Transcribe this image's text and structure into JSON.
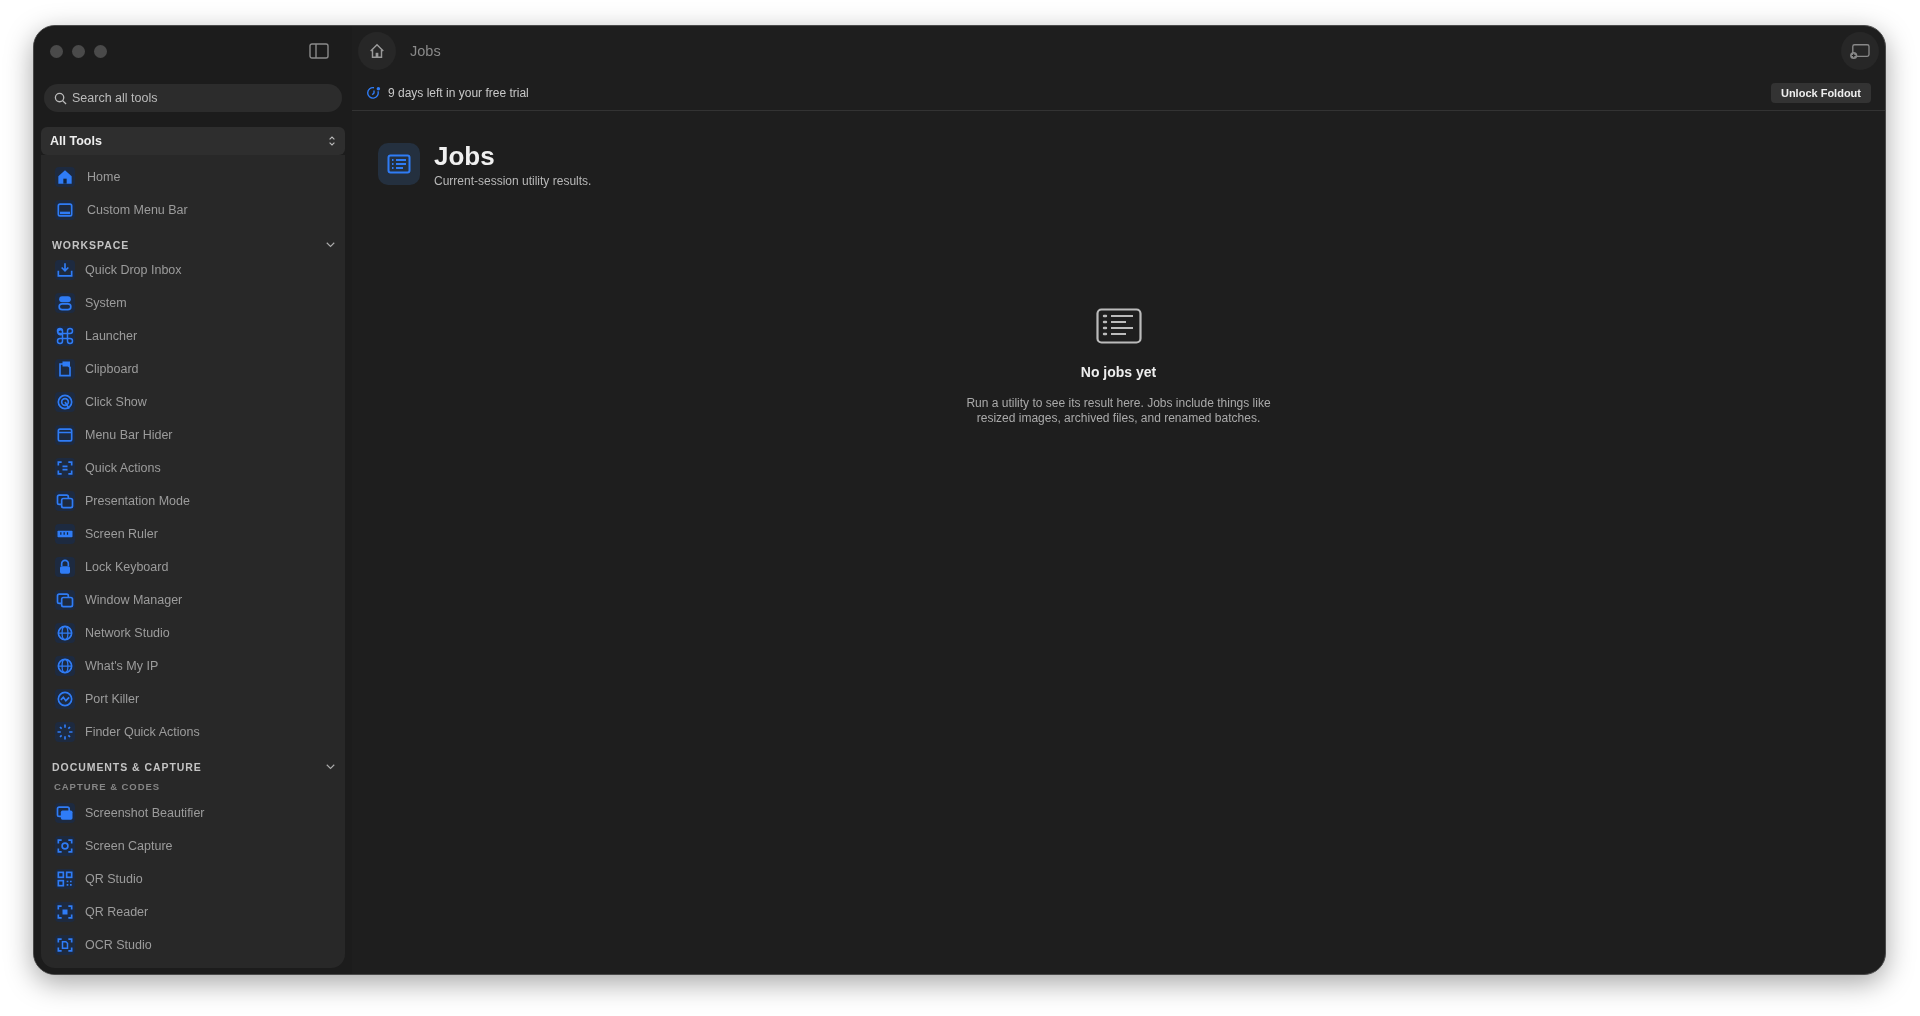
{
  "toolbar": {
    "breadcrumb": "Jobs"
  },
  "sidebar": {
    "search": {
      "placeholder": "Search all tools"
    },
    "scope": {
      "value": "All Tools"
    },
    "pinned": [
      {
        "label": "Home"
      },
      {
        "label": "Custom Menu Bar"
      }
    ],
    "sections": [
      {
        "title": "WORKSPACE",
        "expanded": true,
        "groups": [
          {
            "items": [
              {
                "label": "Quick Drop Inbox"
              },
              {
                "label": "System"
              },
              {
                "label": "Launcher"
              },
              {
                "label": "Clipboard"
              },
              {
                "label": "Click Show"
              },
              {
                "label": "Menu Bar Hider"
              },
              {
                "label": "Quick Actions"
              },
              {
                "label": "Presentation Mode"
              },
              {
                "label": "Screen Ruler"
              },
              {
                "label": "Lock Keyboard"
              },
              {
                "label": "Window Manager"
              },
              {
                "label": "Network Studio"
              },
              {
                "label": "What's My IP"
              },
              {
                "label": "Port Killer"
              },
              {
                "label": "Finder Quick Actions"
              }
            ]
          }
        ]
      },
      {
        "title": "DOCUMENTS & CAPTURE",
        "expanded": true,
        "groups": [
          {
            "title": "CAPTURE & CODES",
            "items": [
              {
                "label": "Screenshot Beautifier"
              },
              {
                "label": "Screen Capture"
              },
              {
                "label": "QR Studio"
              },
              {
                "label": "QR Reader"
              },
              {
                "label": "OCR Studio"
              }
            ]
          }
        ]
      }
    ]
  },
  "trial_banner": {
    "text": "9 days left in your free trial",
    "button": "Unlock Foldout"
  },
  "page": {
    "title": "Jobs",
    "subtitle": "Current-session utility results."
  },
  "empty_state": {
    "title": "No jobs yet",
    "message": "Run a utility to see its result here. Jobs include things like resized images, archived files, and renamed batches."
  }
}
